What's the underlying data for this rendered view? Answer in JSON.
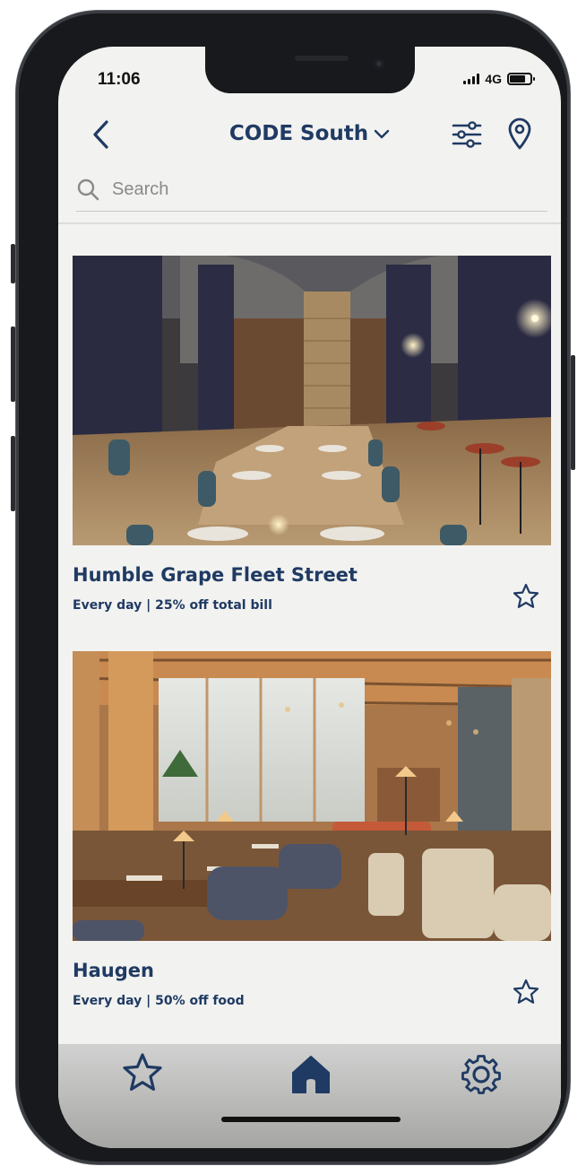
{
  "status_bar": {
    "time": "11:06",
    "network": "4G",
    "battery_level": 0.75
  },
  "header": {
    "title": "CODE South"
  },
  "search": {
    "placeholder": "Search"
  },
  "restaurants": [
    {
      "name": "Humble Grape Fleet Street",
      "offer": "Every day | 25% off total bill",
      "favorited": false
    },
    {
      "name": "Haugen",
      "offer": "Every day | 50% off food",
      "favorited": false
    }
  ],
  "tab_bar": {
    "tabs": [
      {
        "icon": "star-icon",
        "active": false
      },
      {
        "icon": "home-icon",
        "active": true
      },
      {
        "icon": "settings-icon",
        "active": false
      }
    ]
  },
  "colors": {
    "brand_navy": "#1f3a63",
    "background": "#f2f2f0"
  }
}
